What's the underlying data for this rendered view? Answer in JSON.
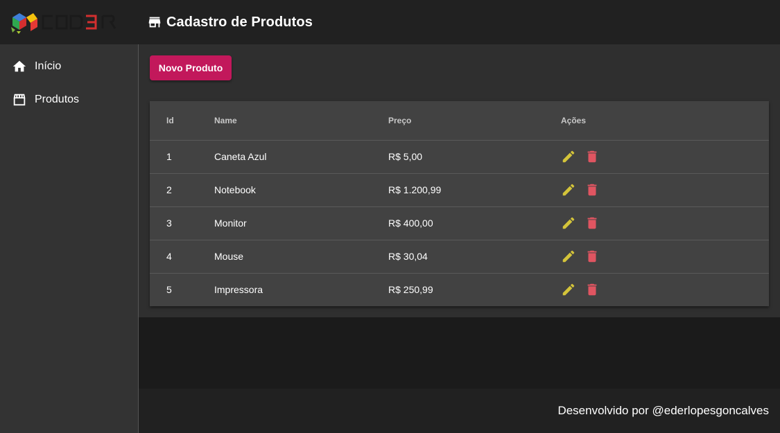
{
  "header": {
    "title": "Cadastro de Produtos",
    "logo_text": "COD3R"
  },
  "sidebar": {
    "items": [
      {
        "label": "Início",
        "icon": "home-icon"
      },
      {
        "label": "Produtos",
        "icon": "store-icon"
      }
    ]
  },
  "main": {
    "new_button_label": "Novo Produto",
    "table": {
      "columns": [
        "Id",
        "Name",
        "Preço",
        "Ações"
      ],
      "rows": [
        {
          "id": "1",
          "name": "Caneta Azul",
          "price": "R$ 5,00"
        },
        {
          "id": "2",
          "name": "Notebook",
          "price": "R$ 1.200,99"
        },
        {
          "id": "3",
          "name": "Monitor",
          "price": "R$ 400,00"
        },
        {
          "id": "4",
          "name": "Mouse",
          "price": "R$ 30,04"
        },
        {
          "id": "5",
          "name": "Impressora",
          "price": "R$ 250,99"
        }
      ],
      "row_actions": [
        {
          "icon": "pencil-icon",
          "color": "#d4c43a"
        },
        {
          "icon": "trash-icon",
          "color": "#e05561"
        }
      ]
    }
  },
  "footer": {
    "text": "Desenvolvido por @ederlopesgoncalves"
  },
  "colors": {
    "accent": "#c2185b",
    "header_bg": "#212121",
    "sidebar_bg": "#333333",
    "content_bg": "#2f2f2f",
    "table_bg": "#424242",
    "edit": "#d4c43a",
    "delete": "#e05561"
  }
}
